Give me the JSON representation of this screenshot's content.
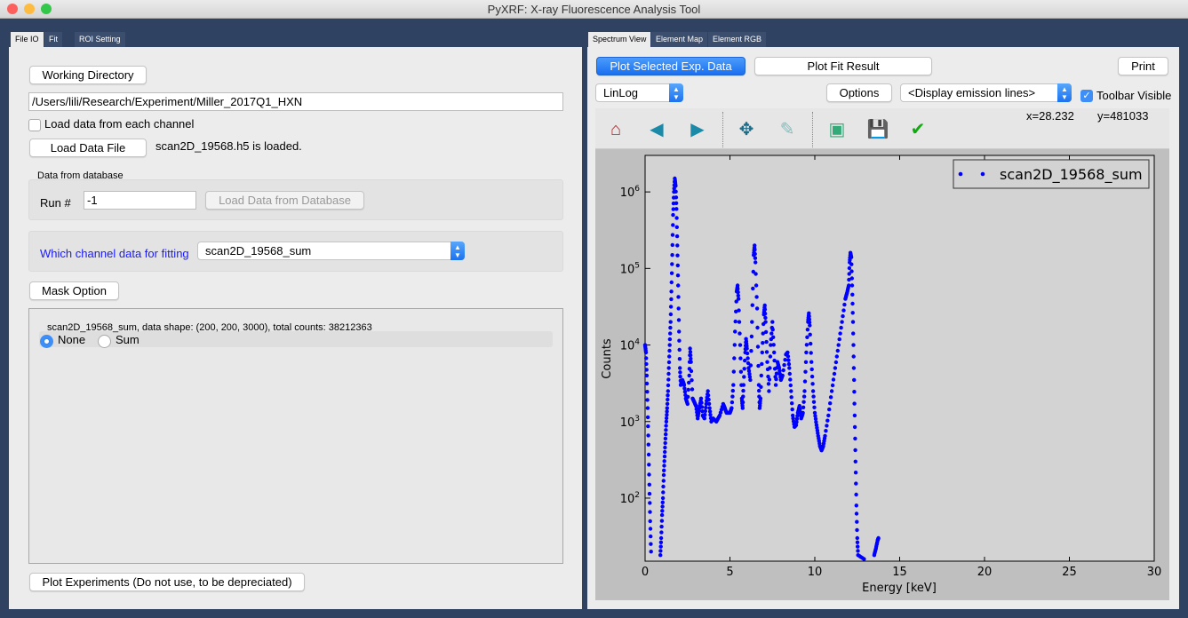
{
  "window": {
    "title": "PyXRF: X-ray Fluorescence Analysis Tool"
  },
  "left": {
    "tabs": [
      "File IO",
      "Fit",
      "ROI Setting"
    ],
    "working_directory_label": "Working Directory",
    "working_directory_value": "/Users/lili/Research/Experiment/Miller_2017Q1_HXN",
    "load_each_channel_label": "Load data from each channel",
    "load_each_channel_checked": false,
    "load_data_file_label": "Load Data File",
    "load_status": "scan2D_19568.h5 is loaded.",
    "database_group_title": "Data from database",
    "run_label": "Run #",
    "run_value": "-1",
    "load_db_label": "Load Data from Database",
    "channel_label": "Which channel data for fitting",
    "channel_value": "scan2D_19568_sum",
    "mask_option_label": "Mask Option",
    "data_info": "scan2D_19568_sum, data shape: (200, 200, 3000), total counts: 38212363",
    "radio_none": "None",
    "radio_sum": "Sum",
    "radio_selected": "None",
    "plot_experiments_label": "Plot Experiments (Do not use, to be depreciated)"
  },
  "right": {
    "tabs": [
      "Spectrum View",
      "Element Map",
      "Element RGB"
    ],
    "plot_selected_label": "Plot Selected Exp. Data",
    "plot_fit_label": "Plot Fit Result",
    "print_label": "Print",
    "scale_value": "LinLog",
    "options_label": "Options",
    "emission_value": "<Display emission lines>",
    "toolbar_visible_label": "Toolbar Visible",
    "toolbar_visible_checked": true,
    "coord_x": "x=28.232",
    "coord_y": "y=481033",
    "toolbar_icons": [
      "home-icon",
      "back-icon",
      "forward-icon",
      "pan-icon",
      "zoom-icon",
      "subplots-icon",
      "save-icon",
      "edit-icon"
    ]
  },
  "chart_data": {
    "type": "scatter",
    "xlabel": "Energy [keV]",
    "ylabel": "Counts",
    "xlim": [
      0,
      30
    ],
    "ylim": [
      15,
      3000000
    ],
    "yscale": "log",
    "xticks": [
      "0",
      "5",
      "10",
      "15",
      "20",
      "25",
      "30"
    ],
    "yticks": [
      "10^2",
      "10^3",
      "10^4",
      "10^5",
      "10^6"
    ],
    "legend_position": "top-right",
    "color": "#0000ff",
    "series": [
      {
        "name": "scan2D_19568_sum",
        "points": [
          [
            0.0,
            10000
          ],
          [
            0.05,
            8000
          ],
          [
            0.1,
            4000
          ],
          [
            0.15,
            1500
          ],
          [
            0.2,
            500
          ],
          [
            0.25,
            150
          ],
          [
            0.3,
            50
          ],
          [
            0.35,
            20
          ],
          [
            0.9,
            18
          ],
          [
            0.95,
            30
          ],
          [
            1.0,
            60
          ],
          [
            1.05,
            100
          ],
          [
            1.1,
            200
          ],
          [
            1.15,
            350
          ],
          [
            1.2,
            600
          ],
          [
            1.25,
            1000
          ],
          [
            1.3,
            1500
          ],
          [
            1.35,
            2500
          ],
          [
            1.4,
            5000
          ],
          [
            1.45,
            10000
          ],
          [
            1.5,
            20000
          ],
          [
            1.55,
            50000
          ],
          [
            1.6,
            150000
          ],
          [
            1.65,
            500000
          ],
          [
            1.7,
            1000000
          ],
          [
            1.75,
            1500000
          ],
          [
            1.8,
            1200000
          ],
          [
            1.85,
            600000
          ],
          [
            1.9,
            200000
          ],
          [
            1.95,
            60000
          ],
          [
            2.0,
            15000
          ],
          [
            2.05,
            5000
          ],
          [
            2.1,
            3000
          ],
          [
            2.2,
            3500
          ],
          [
            2.3,
            3000
          ],
          [
            2.4,
            2000
          ],
          [
            2.5,
            1700
          ],
          [
            2.6,
            4000
          ],
          [
            2.65,
            9000
          ],
          [
            2.7,
            6000
          ],
          [
            2.8,
            2000
          ],
          [
            2.9,
            1800
          ],
          [
            3.0,
            1600
          ],
          [
            3.1,
            1100
          ],
          [
            3.2,
            1500
          ],
          [
            3.3,
            2000
          ],
          [
            3.4,
            1200
          ],
          [
            3.5,
            1100
          ],
          [
            3.6,
            1700
          ],
          [
            3.7,
            2500
          ],
          [
            3.8,
            1500
          ],
          [
            3.9,
            1000
          ],
          [
            4.0,
            1100
          ],
          [
            4.2,
            1000
          ],
          [
            4.4,
            1200
          ],
          [
            4.6,
            1700
          ],
          [
            4.7,
            1500
          ],
          [
            4.8,
            1300
          ],
          [
            5.0,
            1300
          ],
          [
            5.1,
            1500
          ],
          [
            5.2,
            3000
          ],
          [
            5.3,
            15000
          ],
          [
            5.4,
            50000
          ],
          [
            5.45,
            60000
          ],
          [
            5.5,
            40000
          ],
          [
            5.6,
            10000
          ],
          [
            5.7,
            2000
          ],
          [
            5.75,
            1500
          ],
          [
            5.8,
            3000
          ],
          [
            5.9,
            8000
          ],
          [
            5.95,
            12000
          ],
          [
            6.0,
            9000
          ],
          [
            6.1,
            5000
          ],
          [
            6.2,
            3500
          ],
          [
            6.3,
            20000
          ],
          [
            6.4,
            150000
          ],
          [
            6.45,
            200000
          ],
          [
            6.5,
            120000
          ],
          [
            6.6,
            30000
          ],
          [
            6.7,
            3000
          ],
          [
            6.75,
            1500
          ],
          [
            6.8,
            2000
          ],
          [
            6.9,
            8000
          ],
          [
            7.0,
            25000
          ],
          [
            7.05,
            33000
          ],
          [
            7.1,
            20000
          ],
          [
            7.2,
            6000
          ],
          [
            7.3,
            2500
          ],
          [
            7.4,
            10000
          ],
          [
            7.5,
            20000
          ],
          [
            7.6,
            8000
          ],
          [
            7.7,
            3000
          ],
          [
            7.8,
            6000
          ],
          [
            7.9,
            5000
          ],
          [
            8.0,
            3500
          ],
          [
            8.1,
            4000
          ],
          [
            8.3,
            7500
          ],
          [
            8.4,
            8000
          ],
          [
            8.5,
            5000
          ],
          [
            8.6,
            2500
          ],
          [
            8.7,
            1200
          ],
          [
            8.8,
            850
          ],
          [
            8.9,
            900
          ],
          [
            9.0,
            1300
          ],
          [
            9.1,
            1600
          ],
          [
            9.2,
            1100
          ],
          [
            9.3,
            1300
          ],
          [
            9.4,
            2500
          ],
          [
            9.5,
            8000
          ],
          [
            9.6,
            20000
          ],
          [
            9.65,
            26000
          ],
          [
            9.7,
            18000
          ],
          [
            9.8,
            6000
          ],
          [
            9.9,
            2500
          ],
          [
            10.0,
            1300
          ],
          [
            10.1,
            900
          ],
          [
            10.2,
            650
          ],
          [
            10.3,
            480
          ],
          [
            10.4,
            420
          ],
          [
            10.5,
            480
          ],
          [
            10.6,
            650
          ],
          [
            10.8,
            1200
          ],
          [
            11.0,
            2500
          ],
          [
            11.2,
            5000
          ],
          [
            11.4,
            10000
          ],
          [
            11.6,
            20000
          ],
          [
            11.8,
            40000
          ],
          [
            11.9,
            48000
          ],
          [
            12.0,
            60000
          ],
          [
            12.05,
            120000
          ],
          [
            12.1,
            160000
          ],
          [
            12.15,
            140000
          ],
          [
            12.2,
            60000
          ],
          [
            12.25,
            20000
          ],
          [
            12.3,
            5000
          ],
          [
            12.35,
            1200
          ],
          [
            12.4,
            300
          ],
          [
            12.45,
            80
          ],
          [
            12.5,
            30
          ],
          [
            12.55,
            18
          ],
          [
            12.9,
            16
          ],
          [
            13.5,
            18
          ],
          [
            13.6,
            22
          ],
          [
            13.7,
            28
          ],
          [
            13.75,
            30
          ]
        ]
      }
    ]
  }
}
